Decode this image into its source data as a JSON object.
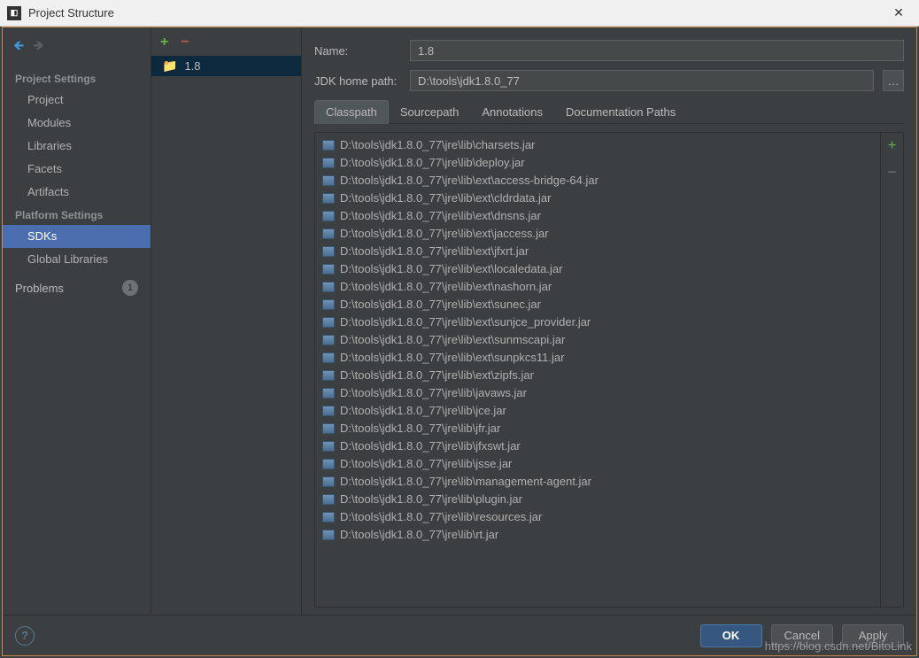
{
  "window": {
    "title": "Project Structure"
  },
  "sidebar": {
    "sections": [
      {
        "header": "Project Settings",
        "items": [
          "Project",
          "Modules",
          "Libraries",
          "Facets",
          "Artifacts"
        ]
      },
      {
        "header": "Platform Settings",
        "items": [
          "SDKs",
          "Global Libraries"
        ]
      }
    ],
    "selected": "SDKs",
    "problems_label": "Problems",
    "problems_count": "1"
  },
  "sdk_list": {
    "items": [
      "1.8"
    ],
    "selected": "1.8"
  },
  "detail": {
    "name_label": "Name:",
    "name_value": "1.8",
    "path_label": "JDK home path:",
    "path_value": "D:\\tools\\jdk1.8.0_77",
    "tabs": [
      "Classpath",
      "Sourcepath",
      "Annotations",
      "Documentation Paths"
    ],
    "active_tab": "Classpath",
    "classpath": [
      "D:\\tools\\jdk1.8.0_77\\jre\\lib\\charsets.jar",
      "D:\\tools\\jdk1.8.0_77\\jre\\lib\\deploy.jar",
      "D:\\tools\\jdk1.8.0_77\\jre\\lib\\ext\\access-bridge-64.jar",
      "D:\\tools\\jdk1.8.0_77\\jre\\lib\\ext\\cldrdata.jar",
      "D:\\tools\\jdk1.8.0_77\\jre\\lib\\ext\\dnsns.jar",
      "D:\\tools\\jdk1.8.0_77\\jre\\lib\\ext\\jaccess.jar",
      "D:\\tools\\jdk1.8.0_77\\jre\\lib\\ext\\jfxrt.jar",
      "D:\\tools\\jdk1.8.0_77\\jre\\lib\\ext\\localedata.jar",
      "D:\\tools\\jdk1.8.0_77\\jre\\lib\\ext\\nashorn.jar",
      "D:\\tools\\jdk1.8.0_77\\jre\\lib\\ext\\sunec.jar",
      "D:\\tools\\jdk1.8.0_77\\jre\\lib\\ext\\sunjce_provider.jar",
      "D:\\tools\\jdk1.8.0_77\\jre\\lib\\ext\\sunmscapi.jar",
      "D:\\tools\\jdk1.8.0_77\\jre\\lib\\ext\\sunpkcs11.jar",
      "D:\\tools\\jdk1.8.0_77\\jre\\lib\\ext\\zipfs.jar",
      "D:\\tools\\jdk1.8.0_77\\jre\\lib\\javaws.jar",
      "D:\\tools\\jdk1.8.0_77\\jre\\lib\\jce.jar",
      "D:\\tools\\jdk1.8.0_77\\jre\\lib\\jfr.jar",
      "D:\\tools\\jdk1.8.0_77\\jre\\lib\\jfxswt.jar",
      "D:\\tools\\jdk1.8.0_77\\jre\\lib\\jsse.jar",
      "D:\\tools\\jdk1.8.0_77\\jre\\lib\\management-agent.jar",
      "D:\\tools\\jdk1.8.0_77\\jre\\lib\\plugin.jar",
      "D:\\tools\\jdk1.8.0_77\\jre\\lib\\resources.jar",
      "D:\\tools\\jdk1.8.0_77\\jre\\lib\\rt.jar"
    ]
  },
  "footer": {
    "ok": "OK",
    "cancel": "Cancel",
    "apply": "Apply"
  },
  "watermark": "https://blog.csdn.net/BitoLink"
}
